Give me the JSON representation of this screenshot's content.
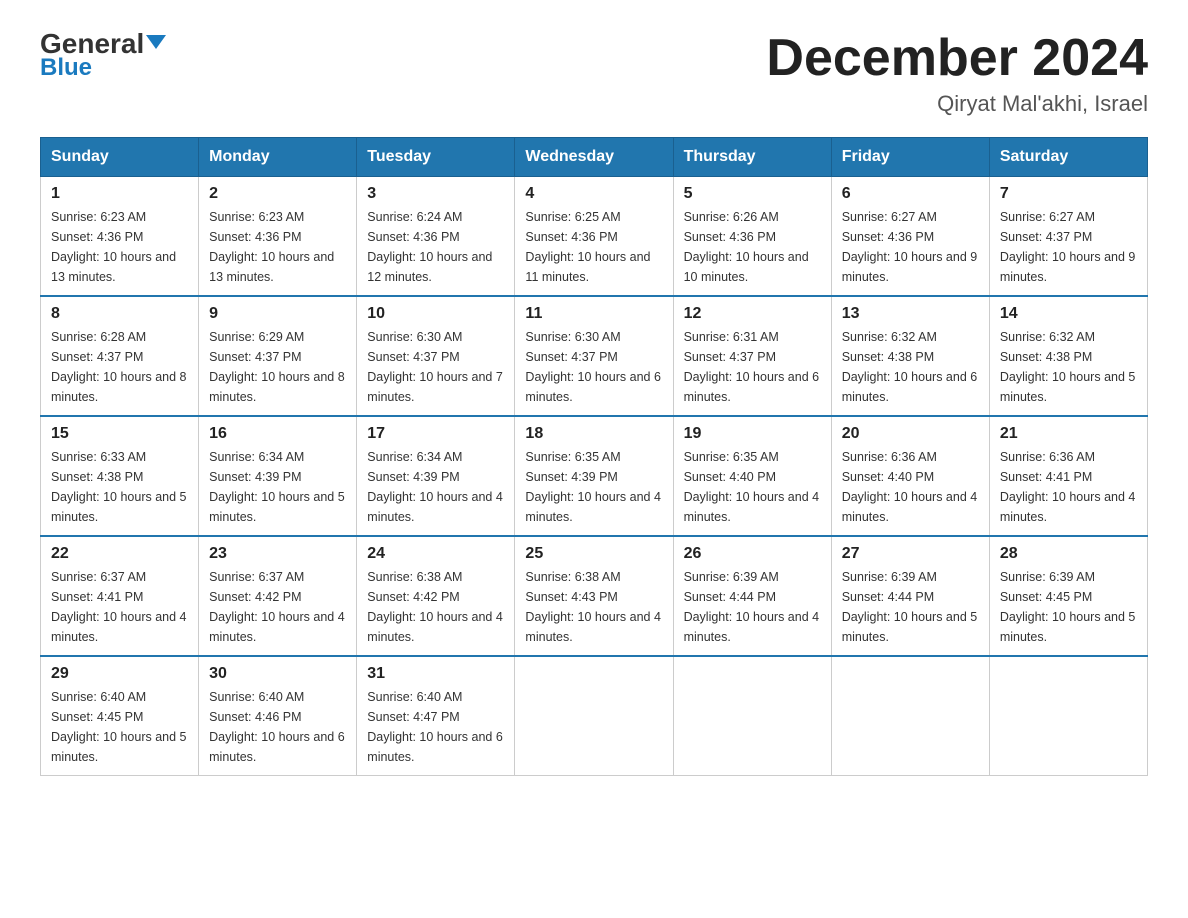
{
  "logo": {
    "text_general": "General",
    "text_blue": "Blue"
  },
  "header": {
    "month": "December 2024",
    "location": "Qiryat Mal'akhi, Israel"
  },
  "weekdays": [
    "Sunday",
    "Monday",
    "Tuesday",
    "Wednesday",
    "Thursday",
    "Friday",
    "Saturday"
  ],
  "weeks": [
    [
      {
        "day": "1",
        "sunrise": "6:23 AM",
        "sunset": "4:36 PM",
        "daylight": "10 hours and 13 minutes."
      },
      {
        "day": "2",
        "sunrise": "6:23 AM",
        "sunset": "4:36 PM",
        "daylight": "10 hours and 13 minutes."
      },
      {
        "day": "3",
        "sunrise": "6:24 AM",
        "sunset": "4:36 PM",
        "daylight": "10 hours and 12 minutes."
      },
      {
        "day": "4",
        "sunrise": "6:25 AM",
        "sunset": "4:36 PM",
        "daylight": "10 hours and 11 minutes."
      },
      {
        "day": "5",
        "sunrise": "6:26 AM",
        "sunset": "4:36 PM",
        "daylight": "10 hours and 10 minutes."
      },
      {
        "day": "6",
        "sunrise": "6:27 AM",
        "sunset": "4:36 PM",
        "daylight": "10 hours and 9 minutes."
      },
      {
        "day": "7",
        "sunrise": "6:27 AM",
        "sunset": "4:37 PM",
        "daylight": "10 hours and 9 minutes."
      }
    ],
    [
      {
        "day": "8",
        "sunrise": "6:28 AM",
        "sunset": "4:37 PM",
        "daylight": "10 hours and 8 minutes."
      },
      {
        "day": "9",
        "sunrise": "6:29 AM",
        "sunset": "4:37 PM",
        "daylight": "10 hours and 8 minutes."
      },
      {
        "day": "10",
        "sunrise": "6:30 AM",
        "sunset": "4:37 PM",
        "daylight": "10 hours and 7 minutes."
      },
      {
        "day": "11",
        "sunrise": "6:30 AM",
        "sunset": "4:37 PM",
        "daylight": "10 hours and 6 minutes."
      },
      {
        "day": "12",
        "sunrise": "6:31 AM",
        "sunset": "4:37 PM",
        "daylight": "10 hours and 6 minutes."
      },
      {
        "day": "13",
        "sunrise": "6:32 AM",
        "sunset": "4:38 PM",
        "daylight": "10 hours and 6 minutes."
      },
      {
        "day": "14",
        "sunrise": "6:32 AM",
        "sunset": "4:38 PM",
        "daylight": "10 hours and 5 minutes."
      }
    ],
    [
      {
        "day": "15",
        "sunrise": "6:33 AM",
        "sunset": "4:38 PM",
        "daylight": "10 hours and 5 minutes."
      },
      {
        "day": "16",
        "sunrise": "6:34 AM",
        "sunset": "4:39 PM",
        "daylight": "10 hours and 5 minutes."
      },
      {
        "day": "17",
        "sunrise": "6:34 AM",
        "sunset": "4:39 PM",
        "daylight": "10 hours and 4 minutes."
      },
      {
        "day": "18",
        "sunrise": "6:35 AM",
        "sunset": "4:39 PM",
        "daylight": "10 hours and 4 minutes."
      },
      {
        "day": "19",
        "sunrise": "6:35 AM",
        "sunset": "4:40 PM",
        "daylight": "10 hours and 4 minutes."
      },
      {
        "day": "20",
        "sunrise": "6:36 AM",
        "sunset": "4:40 PM",
        "daylight": "10 hours and 4 minutes."
      },
      {
        "day": "21",
        "sunrise": "6:36 AM",
        "sunset": "4:41 PM",
        "daylight": "10 hours and 4 minutes."
      }
    ],
    [
      {
        "day": "22",
        "sunrise": "6:37 AM",
        "sunset": "4:41 PM",
        "daylight": "10 hours and 4 minutes."
      },
      {
        "day": "23",
        "sunrise": "6:37 AM",
        "sunset": "4:42 PM",
        "daylight": "10 hours and 4 minutes."
      },
      {
        "day": "24",
        "sunrise": "6:38 AM",
        "sunset": "4:42 PM",
        "daylight": "10 hours and 4 minutes."
      },
      {
        "day": "25",
        "sunrise": "6:38 AM",
        "sunset": "4:43 PM",
        "daylight": "10 hours and 4 minutes."
      },
      {
        "day": "26",
        "sunrise": "6:39 AM",
        "sunset": "4:44 PM",
        "daylight": "10 hours and 4 minutes."
      },
      {
        "day": "27",
        "sunrise": "6:39 AM",
        "sunset": "4:44 PM",
        "daylight": "10 hours and 5 minutes."
      },
      {
        "day": "28",
        "sunrise": "6:39 AM",
        "sunset": "4:45 PM",
        "daylight": "10 hours and 5 minutes."
      }
    ],
    [
      {
        "day": "29",
        "sunrise": "6:40 AM",
        "sunset": "4:45 PM",
        "daylight": "10 hours and 5 minutes."
      },
      {
        "day": "30",
        "sunrise": "6:40 AM",
        "sunset": "4:46 PM",
        "daylight": "10 hours and 6 minutes."
      },
      {
        "day": "31",
        "sunrise": "6:40 AM",
        "sunset": "4:47 PM",
        "daylight": "10 hours and 6 minutes."
      },
      null,
      null,
      null,
      null
    ]
  ]
}
